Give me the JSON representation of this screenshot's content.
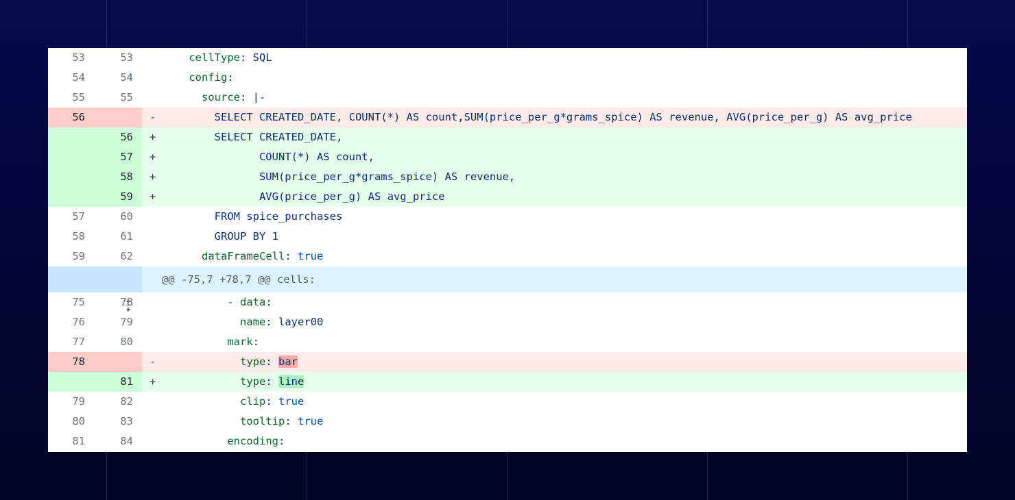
{
  "rows": [
    {
      "type": "ctx",
      "old": "53",
      "new": "53",
      "indent": "    ",
      "key": "cellType",
      "sep": ": ",
      "value": "SQL"
    },
    {
      "type": "ctx",
      "old": "54",
      "new": "54",
      "indent": "    ",
      "key": "config",
      "sep": ":",
      "value": ""
    },
    {
      "type": "ctx",
      "old": "55",
      "new": "55",
      "indent": "      ",
      "key": "source",
      "sep": ": ",
      "value": "|-"
    },
    {
      "type": "del",
      "old": "56",
      "new": "",
      "mark": "-",
      "text": "        SELECT CREATED_DATE, COUNT(*) AS count,SUM(price_per_g*grams_spice) AS revenue, AVG(price_per_g) AS avg_price"
    },
    {
      "type": "add",
      "old": "",
      "new": "56",
      "mark": "+",
      "text": "        SELECT CREATED_DATE,"
    },
    {
      "type": "add",
      "old": "",
      "new": "57",
      "mark": "+",
      "text": "               COUNT(*) AS count,"
    },
    {
      "type": "add",
      "old": "",
      "new": "58",
      "mark": "+",
      "text": "               SUM(price_per_g*grams_spice) AS revenue,"
    },
    {
      "type": "add",
      "old": "",
      "new": "59",
      "mark": "+",
      "text": "               AVG(price_per_g) AS avg_price"
    },
    {
      "type": "ctx",
      "old": "57",
      "new": "60",
      "text": "        FROM spice_purchases"
    },
    {
      "type": "ctx",
      "old": "58",
      "new": "61",
      "text": "        GROUP BY 1"
    },
    {
      "type": "ctx",
      "old": "59",
      "new": "62",
      "indent": "      ",
      "key": "dataFrameCell",
      "sep": ": ",
      "value": "true"
    },
    {
      "type": "hunk",
      "text": "@@ -75,7 +78,7 @@ cells:"
    },
    {
      "type": "ctx",
      "old": "75",
      "new": "78",
      "indent": "          ",
      "key": "- data",
      "sep": ":",
      "value": ""
    },
    {
      "type": "ctx",
      "old": "76",
      "new": "79",
      "indent": "            ",
      "key": "name",
      "sep": ": ",
      "value": "layer00"
    },
    {
      "type": "ctx",
      "old": "77",
      "new": "80",
      "indent": "          ",
      "key": "mark",
      "sep": ":",
      "value": ""
    },
    {
      "type": "del",
      "old": "78",
      "new": "",
      "mark": "-",
      "indent": "            ",
      "key": "type",
      "sep": ": ",
      "hl": "bar"
    },
    {
      "type": "add",
      "old": "",
      "new": "81",
      "mark": "+",
      "indent": "            ",
      "key": "type",
      "sep": ": ",
      "hl": "line"
    },
    {
      "type": "ctx",
      "old": "79",
      "new": "82",
      "indent": "            ",
      "key": "clip",
      "sep": ": ",
      "value": "true"
    },
    {
      "type": "ctx",
      "old": "80",
      "new": "83",
      "indent": "            ",
      "key": "tooltip",
      "sep": ": ",
      "value": "true"
    },
    {
      "type": "ctx",
      "old": "81",
      "new": "84",
      "indent": "          ",
      "key": "encoding",
      "sep": ":",
      "value": ""
    }
  ],
  "icons": {
    "expand": "expand-lines-icon"
  }
}
